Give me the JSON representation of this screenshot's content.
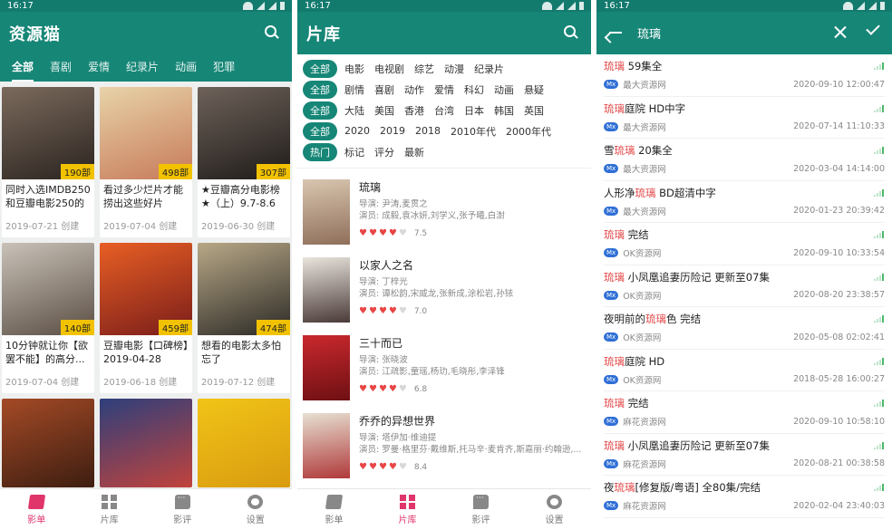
{
  "panel1": {
    "status_time": "16:17",
    "app_title": "资源猫",
    "tabs": [
      "全部",
      "喜剧",
      "爱情",
      "纪录片",
      "动画",
      "犯罪"
    ],
    "cards": [
      {
        "title": "同时入选IMDB250和豆瓣电影250的",
        "count": "190部",
        "date": "2019-07-21 创建",
        "c1": "#7b6a5c",
        "c2": "#2b2420"
      },
      {
        "title": "看过多少烂片才能捞出这些好片",
        "count": "498部",
        "date": "2019-07-04 创建",
        "c1": "#e8d3a8",
        "c2": "#c77a5a"
      },
      {
        "title": "★豆瓣高分电影榜★（上）9.7-8.6",
        "count": "307部",
        "date": "2019-06-30 创建",
        "c1": "#6e625a",
        "c2": "#1f1b19"
      },
      {
        "title": "10分钟就让你【欲罢不能】的高分...",
        "count": "140部",
        "date": "2019-07-04 创建",
        "c1": "#c9c2b8",
        "c2": "#5b4e44"
      },
      {
        "title": "豆瓣电影【口碑榜】2019-04-28",
        "count": "459部",
        "date": "2019-06-18 创建",
        "c1": "#e85f24",
        "c2": "#7a1d1a"
      },
      {
        "title": "想看的电影太多怕忘了",
        "count": "474部",
        "date": "2019-07-12 创建",
        "c1": "#b8a887",
        "c2": "#2c2a26"
      },
      {
        "title": "",
        "count": "",
        "date": "",
        "c1": "#a44a26",
        "c2": "#3a1c10"
      },
      {
        "title": "",
        "count": "",
        "date": "",
        "c1": "#2d3f7c",
        "c2": "#c6433a"
      },
      {
        "title": "",
        "count": "",
        "date": "",
        "c1": "#f1c417",
        "c2": "#d89a10"
      }
    ]
  },
  "panel2": {
    "status_time": "16:17",
    "title": "片库",
    "filter_rows": [
      {
        "pill": "全部",
        "options": [
          "电影",
          "电视剧",
          "综艺",
          "动漫",
          "纪录片"
        ]
      },
      {
        "pill": "全部",
        "options": [
          "剧情",
          "喜剧",
          "动作",
          "爱情",
          "科幻",
          "动画",
          "悬疑"
        ]
      },
      {
        "pill": "全部",
        "options": [
          "大陆",
          "美国",
          "香港",
          "台湾",
          "日本",
          "韩国",
          "英国"
        ]
      },
      {
        "pill": "全部",
        "options": [
          "2020",
          "2019",
          "2018",
          "2010年代",
          "2000年代"
        ]
      },
      {
        "pill": "热门",
        "options": [
          "标记",
          "评分",
          "最新"
        ]
      }
    ],
    "movies": [
      {
        "title": "琉璃",
        "director": "导演: 尹涛,麦贯之",
        "actors": "演员: 成毅,袁冰妍,刘学义,张予曦,白澍",
        "hearts": 4,
        "rating": "7.5",
        "c1": "#d9c6b0",
        "c2": "#8f6f5a"
      },
      {
        "title": "以家人之名",
        "director": "导演: 丁梓光",
        "actors": "演员: 谭松韵,宋威龙,张新成,涂松岩,孙铱",
        "hearts": 3.5,
        "rating": "7.0",
        "c1": "#e9e4dd",
        "c2": "#4a3a38"
      },
      {
        "title": "三十而已",
        "director": "导演: 张晓波",
        "actors": "演员: 江疏影,童瑶,杨玏,毛晓彤,李泽锋",
        "hearts": 3.5,
        "rating": "6.8",
        "c1": "#c9282d",
        "c2": "#6e1013"
      },
      {
        "title": "乔乔的异想世界",
        "director": "导演: 塔伊加·维迪提",
        "actors": "演员: 罗曼·格里芬·戴维斯,托马辛·麦肯齐,斯嘉丽·约翰逊,...",
        "hearts": 4,
        "rating": "8.4",
        "c1": "#e7e0d2",
        "c2": "#b0393a"
      }
    ]
  },
  "panel3": {
    "status_time": "16:17",
    "search_value": "琉璃",
    "results": [
      {
        "pre": "",
        "hl": "琉璃",
        "post": " 59集全",
        "source": "最大资源网",
        "date": "2020-09-10 12:00:47"
      },
      {
        "pre": "",
        "hl": "琉璃",
        "post": "庭院 HD中字",
        "source": "最大资源网",
        "date": "2020-07-14 11:10:33"
      },
      {
        "pre": "雪",
        "hl": "琉璃",
        "post": " 20集全",
        "source": "最大资源网",
        "date": "2020-03-04 14:14:00"
      },
      {
        "pre": "人形净",
        "hl": "琉璃",
        "post": " BD超清中字",
        "source": "最大资源网",
        "date": "2020-01-23 20:39:42"
      },
      {
        "pre": "",
        "hl": "琉璃",
        "post": " 完结",
        "source": "OK资源网",
        "date": "2020-09-10 10:33:54"
      },
      {
        "pre": "",
        "hl": "琉璃",
        "post": " 小凤凰追妻历险记 更新至07集",
        "source": "OK资源网",
        "date": "2020-08-20 23:38:57"
      },
      {
        "pre": "夜明前的",
        "hl": "琉璃",
        "post": "色 完结",
        "source": "OK资源网",
        "date": "2020-05-08 02:02:41"
      },
      {
        "pre": "",
        "hl": "琉璃",
        "post": "庭院 HD",
        "source": "OK资源网",
        "date": "2018-05-28 16:00:27"
      },
      {
        "pre": "",
        "hl": "琉璃",
        "post": " 完结",
        "source": "麻花资源网",
        "date": "2020-09-10 10:58:10"
      },
      {
        "pre": "",
        "hl": "琉璃",
        "post": " 小凤凰追妻历险记 更新至07集",
        "source": "麻花资源网",
        "date": "2020-08-21 00:38:58"
      },
      {
        "pre": "夜",
        "hl": "琉璃",
        "post": "[修复版/粤语] 全80集/完结",
        "source": "麻花资源网",
        "date": "2020-02-04 23:40:03"
      }
    ],
    "source_tag": "Mx"
  },
  "bottom_nav": [
    {
      "label": "影单",
      "icon": "film-icon"
    },
    {
      "label": "片库",
      "icon": "grid-icon"
    },
    {
      "label": "影评",
      "icon": "chat-icon"
    },
    {
      "label": "设置",
      "icon": "gear-icon"
    }
  ],
  "colors": {
    "primary": "#168677",
    "accent": "#e0356b",
    "highlight": "#e34747",
    "badge": "#f2c200"
  }
}
